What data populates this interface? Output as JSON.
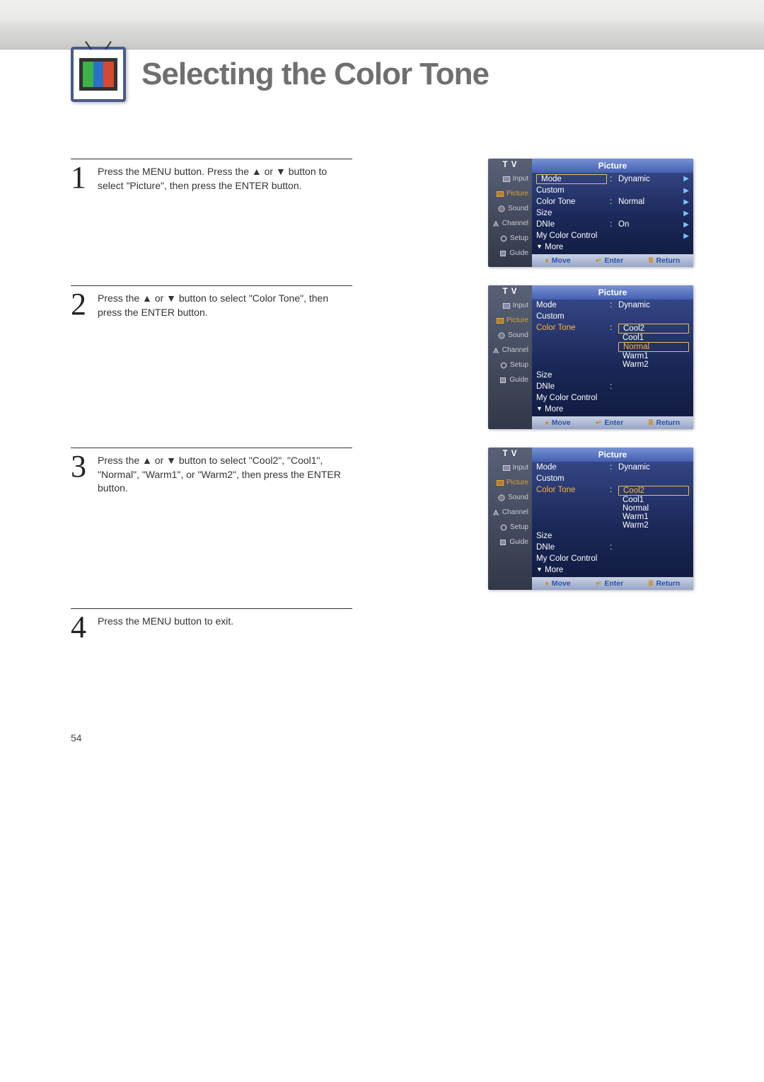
{
  "page": {
    "title": "Selecting the Color Tone",
    "number": "54"
  },
  "steps": [
    {
      "num": "1",
      "text": "Press the MENU button. Press the ▲ or ▼ button to select \"Picture\", then press the ENTER button."
    },
    {
      "num": "2",
      "text": "Press the ▲ or ▼ button to select \"Color Tone\", then press the ENTER button."
    },
    {
      "num": "3",
      "text": "Press the ▲ or ▼ button to select \"Cool2\", \"Cool1\", \"Normal\", \"Warm1\", or \"Warm2\",  then press the ENTER button."
    },
    {
      "num": "4",
      "text": "Press the MENU button to exit."
    }
  ],
  "sidebar": {
    "title": "T V",
    "items": [
      {
        "label": "Input"
      },
      {
        "label": "Picture"
      },
      {
        "label": "Sound"
      },
      {
        "label": "Channel"
      },
      {
        "label": "Setup"
      },
      {
        "label": "Guide"
      }
    ]
  },
  "osd_title": "Picture",
  "menu_labels": {
    "mode": "Mode",
    "custom": "Custom",
    "color_tone": "Color Tone",
    "size": "Size",
    "dnie": "DNIe",
    "my_color": "My Color Control",
    "more": "More"
  },
  "values": {
    "mode": "Dynamic",
    "color_tone_normal": "Normal",
    "dnie_on": "On"
  },
  "options": {
    "color_tone": [
      "Cool2",
      "Cool1",
      "Normal",
      "Warm1",
      "Warm2"
    ]
  },
  "hints": {
    "move": "Move",
    "enter": "Enter",
    "return": "Return"
  },
  "glyphs": {
    "right": "▶",
    "down": "▼",
    "updown": "◆",
    "enter": "↵",
    "return": "⦾"
  }
}
